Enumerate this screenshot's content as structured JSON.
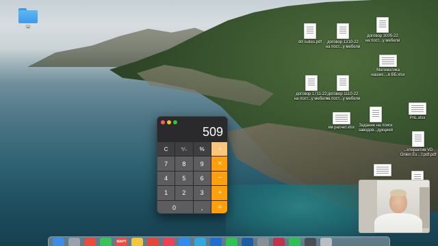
{
  "desktop": {
    "folder": {
      "label": "ш",
      "icon": "folder-icon"
    },
    "files": [
      {
        "id": "f1",
        "label": "dd suites.pdf",
        "icon": "pdf-document-icon"
      },
      {
        "id": "f2",
        "label": "договор 1310-22\nна пост...у мебели",
        "icon": "document-icon"
      },
      {
        "id": "f3",
        "label": "договор 3005-22\nна пост...у мебели",
        "icon": "document-icon"
      },
      {
        "id": "f4",
        "label": "Математика\nнаших....в ВБ.xlsx",
        "icon": "spreadsheet-icon"
      },
      {
        "id": "f5",
        "label": "договор 1711-22\nна пост...у мебели",
        "icon": "document-icon"
      },
      {
        "id": "f6",
        "label": "договор 1110-22\nна пост...у мебели",
        "icon": "document-icon"
      },
      {
        "id": "f7",
        "label": "Задание на поиск\nзаводов...дукцией",
        "icon": "document-icon"
      },
      {
        "id": "f8",
        "label": "PnL.xlsx",
        "icon": "spreadsheet-icon"
      },
      {
        "id": "f9",
        "label": "км расчет.xlsx",
        "icon": "spreadsheet-icon"
      },
      {
        "id": "f10",
        "label": "...нтерактив VD\nOnlen Ev....f.pdf.pdf",
        "icon": "pdf-document-icon"
      }
    ]
  },
  "calculator": {
    "display": "509",
    "keys": [
      {
        "label": "C",
        "kind": "fn",
        "name": "clear-key"
      },
      {
        "label": "⁺∕₋",
        "kind": "fn",
        "name": "sign-key"
      },
      {
        "label": "%",
        "kind": "fn",
        "name": "percent-key"
      },
      {
        "label": "÷",
        "kind": "op",
        "name": "divide-key"
      },
      {
        "label": "7",
        "kind": "num",
        "name": "digit-7-key"
      },
      {
        "label": "8",
        "kind": "num",
        "name": "digit-8-key"
      },
      {
        "label": "9",
        "kind": "num",
        "name": "digit-9-key"
      },
      {
        "label": "×",
        "kind": "op",
        "name": "multiply-key"
      },
      {
        "label": "4",
        "kind": "num",
        "name": "digit-4-key"
      },
      {
        "label": "5",
        "kind": "num",
        "name": "digit-5-key"
      },
      {
        "label": "6",
        "kind": "num",
        "name": "digit-6-key"
      },
      {
        "label": "−",
        "kind": "op",
        "name": "minus-key"
      },
      {
        "label": "1",
        "kind": "num",
        "name": "digit-1-key"
      },
      {
        "label": "2",
        "kind": "num",
        "name": "digit-2-key"
      },
      {
        "label": "3",
        "kind": "num",
        "name": "digit-3-key"
      },
      {
        "label": "+",
        "kind": "op",
        "name": "plus-key"
      },
      {
        "label": "0",
        "kind": "num zero",
        "name": "digit-0-key"
      },
      {
        "label": ",",
        "kind": "num",
        "name": "decimal-key"
      },
      {
        "label": "=",
        "kind": "op",
        "name": "equals-key"
      }
    ]
  },
  "webcam": {
    "label": "webcam-overlay"
  },
  "dock": {
    "items": [
      {
        "name": "finder-dock-icon",
        "color": "#3a8ee6",
        "text": ""
      },
      {
        "name": "launchpad-dock-icon",
        "color": "#9aa3ad",
        "text": ""
      },
      {
        "name": "chrome-dock-icon",
        "color": "#e94b3c",
        "text": ""
      },
      {
        "name": "messages-dock-icon",
        "color": "#3bc35a",
        "text": ""
      },
      {
        "name": "calendar-dock-icon",
        "color": "#f04a3d",
        "text": "МАРТ"
      },
      {
        "name": "notes-dock-icon",
        "color": "#f3c63f",
        "text": ""
      },
      {
        "name": "browser-dock-icon",
        "color": "#e2473e",
        "text": ""
      },
      {
        "name": "music-dock-icon",
        "color": "#f04058",
        "text": ""
      },
      {
        "name": "appstore-dock-icon",
        "color": "#2d8ef0",
        "text": ""
      },
      {
        "name": "telegram-dock-icon",
        "color": "#33a8e0",
        "text": ""
      },
      {
        "name": "app-dock-icon",
        "color": "#1d6fd1",
        "text": ""
      },
      {
        "name": "whatsapp-dock-icon",
        "color": "#2ec453",
        "text": ""
      },
      {
        "name": "app-dock-icon",
        "color": "#1b5ea8",
        "text": ""
      },
      {
        "name": "settings-dock-icon",
        "color": "#8a8f96",
        "text": ""
      },
      {
        "name": "app-dock-icon",
        "color": "#c0334a",
        "text": ""
      },
      {
        "name": "facetime-dock-icon",
        "color": "#2fbf55",
        "text": ""
      },
      {
        "name": "app-dock-icon",
        "color": "#4b4f55",
        "text": ""
      },
      {
        "name": "trash-dock-icon",
        "color": "#b9bec4",
        "text": ""
      }
    ]
  }
}
